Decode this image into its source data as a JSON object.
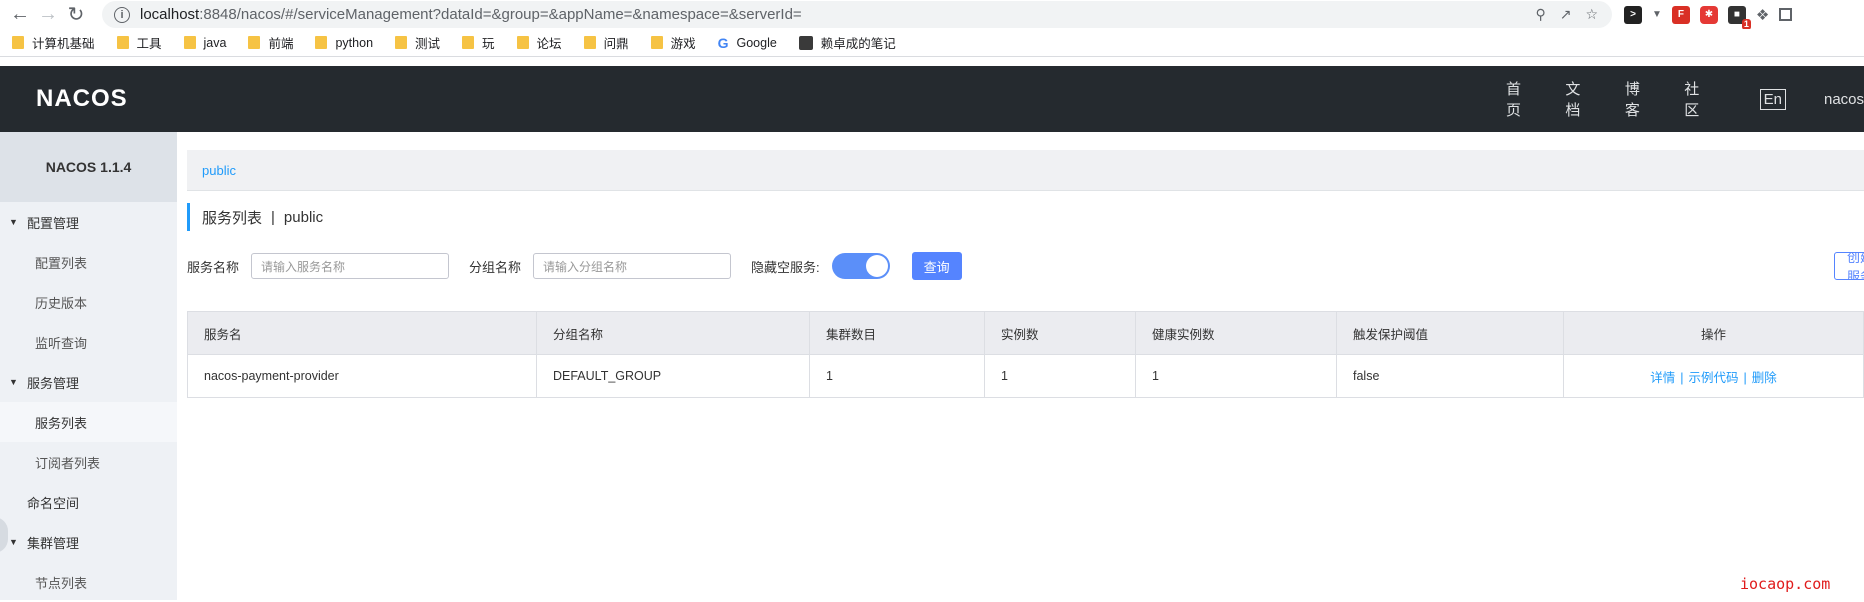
{
  "browser": {
    "url_host": "localhost",
    "url_rest": ":8848/nacos/#/serviceManagement?dataId=&group=&appName=&namespace=&serverId=",
    "bookmarks": [
      "计算机基础",
      "工具",
      "java",
      "前端",
      "python",
      "测试",
      "玩",
      "论坛",
      "问鼎",
      "游戏",
      "Google",
      "赖卓成的笔记"
    ]
  },
  "header": {
    "logo": "NACOS",
    "nav": [
      "首页",
      "文档",
      "博客",
      "社区"
    ],
    "lang": "En",
    "user": "nacos"
  },
  "sidebar": {
    "title": "NACOS 1.1.4",
    "groups": [
      {
        "label": "配置管理",
        "items": [
          "配置列表",
          "历史版本",
          "监听查询"
        ]
      },
      {
        "label": "服务管理",
        "items": [
          "服务列表",
          "订阅者列表"
        ]
      },
      {
        "label": "命名空间"
      },
      {
        "label": "集群管理",
        "items": [
          "节点列表"
        ]
      }
    ]
  },
  "main": {
    "namespace": "public",
    "title": "服务列表",
    "title_namespace": "public",
    "filters": {
      "service_label": "服务名称",
      "service_placeholder": "请输入服务名称",
      "group_label": "分组名称",
      "group_placeholder": "请输入分组名称",
      "hide_empty_label": "隐藏空服务:",
      "query_button": "查询",
      "create_button": "创建服务"
    },
    "table": {
      "headers": [
        "服务名",
        "分组名称",
        "集群数目",
        "实例数",
        "健康实例数",
        "触发保护阈值",
        "操作"
      ],
      "rows": [
        {
          "cells": [
            "nacos-payment-provider",
            "DEFAULT_GROUP",
            "1",
            "1",
            "1",
            "false"
          ],
          "ops": [
            "详情",
            "示例代码",
            "删除"
          ]
        }
      ]
    }
  },
  "watermark": "iocaop.com",
  "colors": {
    "accent": "#209bfa",
    "header_bg": "#252a2f",
    "primary_button": "#5584ff"
  }
}
